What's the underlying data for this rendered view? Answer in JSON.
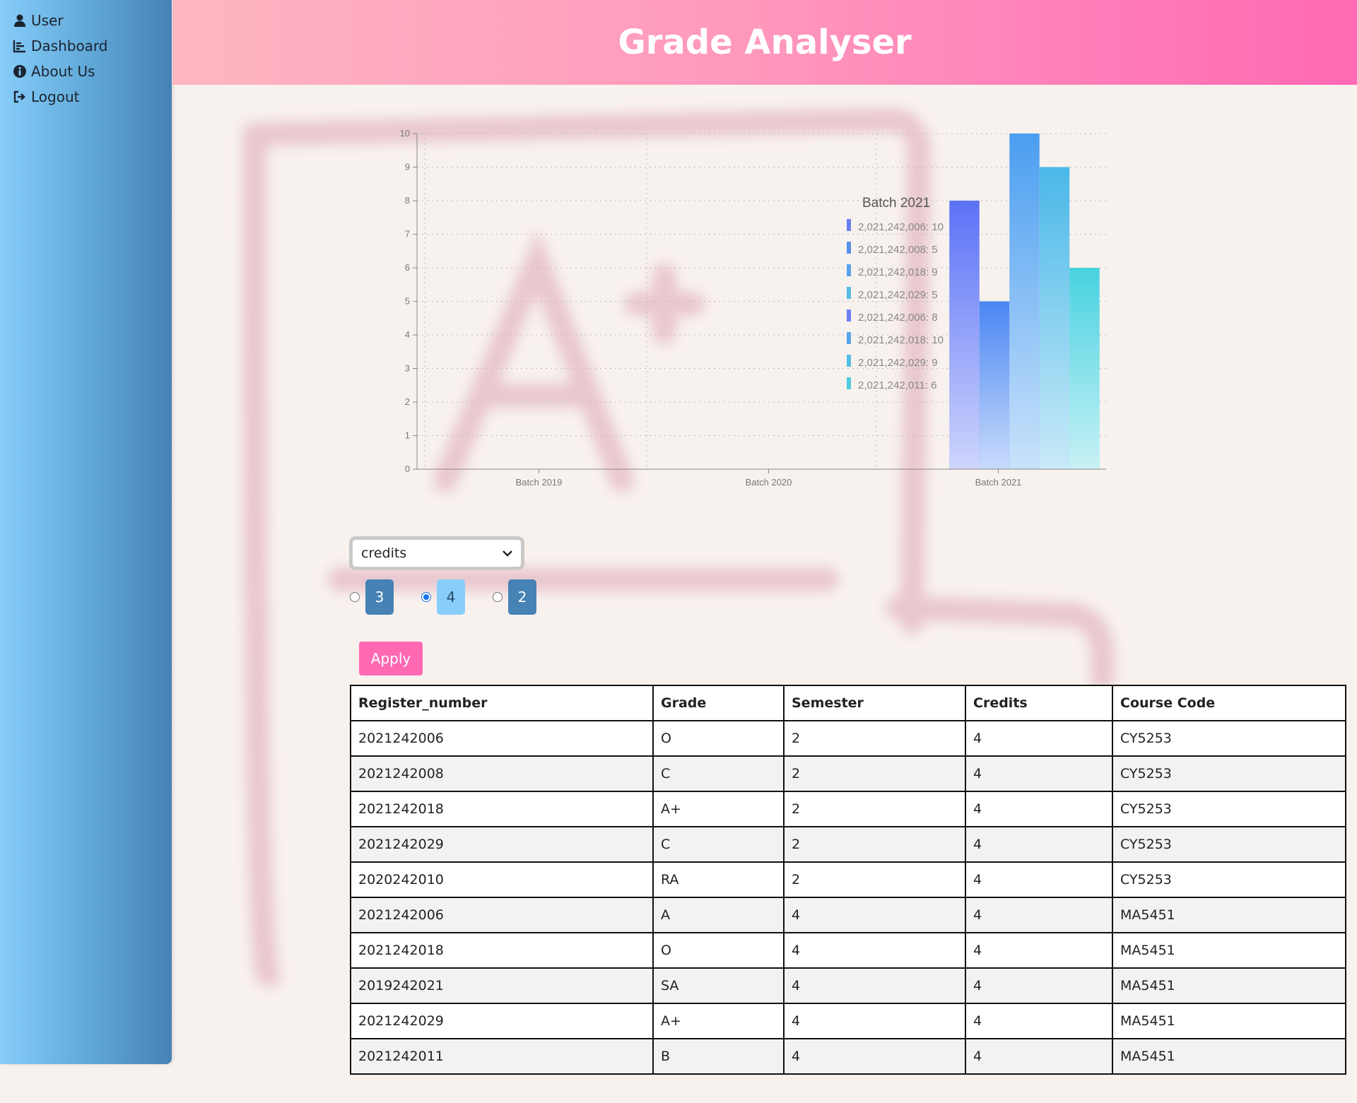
{
  "app": {
    "title": "Grade Analyser"
  },
  "sidebar": {
    "items": [
      {
        "label": "User",
        "icon": "user-icon"
      },
      {
        "label": "Dashboard",
        "icon": "chart-icon"
      },
      {
        "label": "About Us",
        "icon": "info-icon"
      },
      {
        "label": "Logout",
        "icon": "logout-icon"
      }
    ]
  },
  "colors": {
    "header_start": "#ffb6c1",
    "header_end": "#ff69b4",
    "sidebar_start": "#87cefa",
    "sidebar_end": "#4682b4",
    "apply_button": "#ff69b4",
    "chip": "#4682b4",
    "chip_active": "#87cefa"
  },
  "chart_data": {
    "type": "bar",
    "categories": [
      "Batch 2019",
      "Batch 2020",
      "Batch 2021"
    ],
    "ylim": [
      0,
      10
    ],
    "yticks": [
      0,
      1,
      2,
      3,
      4,
      5,
      6,
      7,
      8,
      9,
      10
    ],
    "grid": true,
    "series": [
      {
        "category": "Batch 2021",
        "values": [
          8,
          5,
          10,
          9,
          6
        ],
        "colors": [
          "#5b72f6",
          "#4a86f2",
          "#4b9ef0",
          "#4ab8e8",
          "#48d2e0"
        ]
      }
    ],
    "tooltip": {
      "title": "Batch 2021",
      "entries": [
        {
          "text": "2,021,242,006: 10",
          "color": "#6a7ff5"
        },
        {
          "text": "2,021,242,008: 5",
          "color": "#5a8fee"
        },
        {
          "text": "2,021,242,018: 9",
          "color": "#55a4ec"
        },
        {
          "text": "2,021,242,029: 5",
          "color": "#55bde6"
        },
        {
          "text": "2,021,242,006: 8",
          "color": "#6a7ff5"
        },
        {
          "text": "2,021,242,018: 10",
          "color": "#55a4ec"
        },
        {
          "text": "2,021,242,029: 9",
          "color": "#55bde6"
        },
        {
          "text": "2,021,242,011: 6",
          "color": "#50cbe0"
        }
      ]
    }
  },
  "filter": {
    "selected": "credits",
    "options": [
      {
        "label": "3",
        "checked": false
      },
      {
        "label": "4",
        "checked": true
      },
      {
        "label": "2",
        "checked": false
      }
    ],
    "apply_label": "Apply"
  },
  "table": {
    "headers": [
      "Register_number",
      "Grade",
      "Semester",
      "Credits",
      "Course Code"
    ],
    "rows": [
      [
        "2021242006",
        "O",
        "2",
        "4",
        "CY5253"
      ],
      [
        "2021242008",
        "C",
        "2",
        "4",
        "CY5253"
      ],
      [
        "2021242018",
        "A+",
        "2",
        "4",
        "CY5253"
      ],
      [
        "2021242029",
        "C",
        "2",
        "4",
        "CY5253"
      ],
      [
        "2020242010",
        "RA",
        "2",
        "4",
        "CY5253"
      ],
      [
        "2021242006",
        "A",
        "4",
        "4",
        "MA5451"
      ],
      [
        "2021242018",
        "O",
        "4",
        "4",
        "MA5451"
      ],
      [
        "2019242021",
        "SA",
        "4",
        "4",
        "MA5451"
      ],
      [
        "2021242029",
        "A+",
        "4",
        "4",
        "MA5451"
      ],
      [
        "2021242011",
        "B",
        "4",
        "4",
        "MA5451"
      ]
    ]
  }
}
